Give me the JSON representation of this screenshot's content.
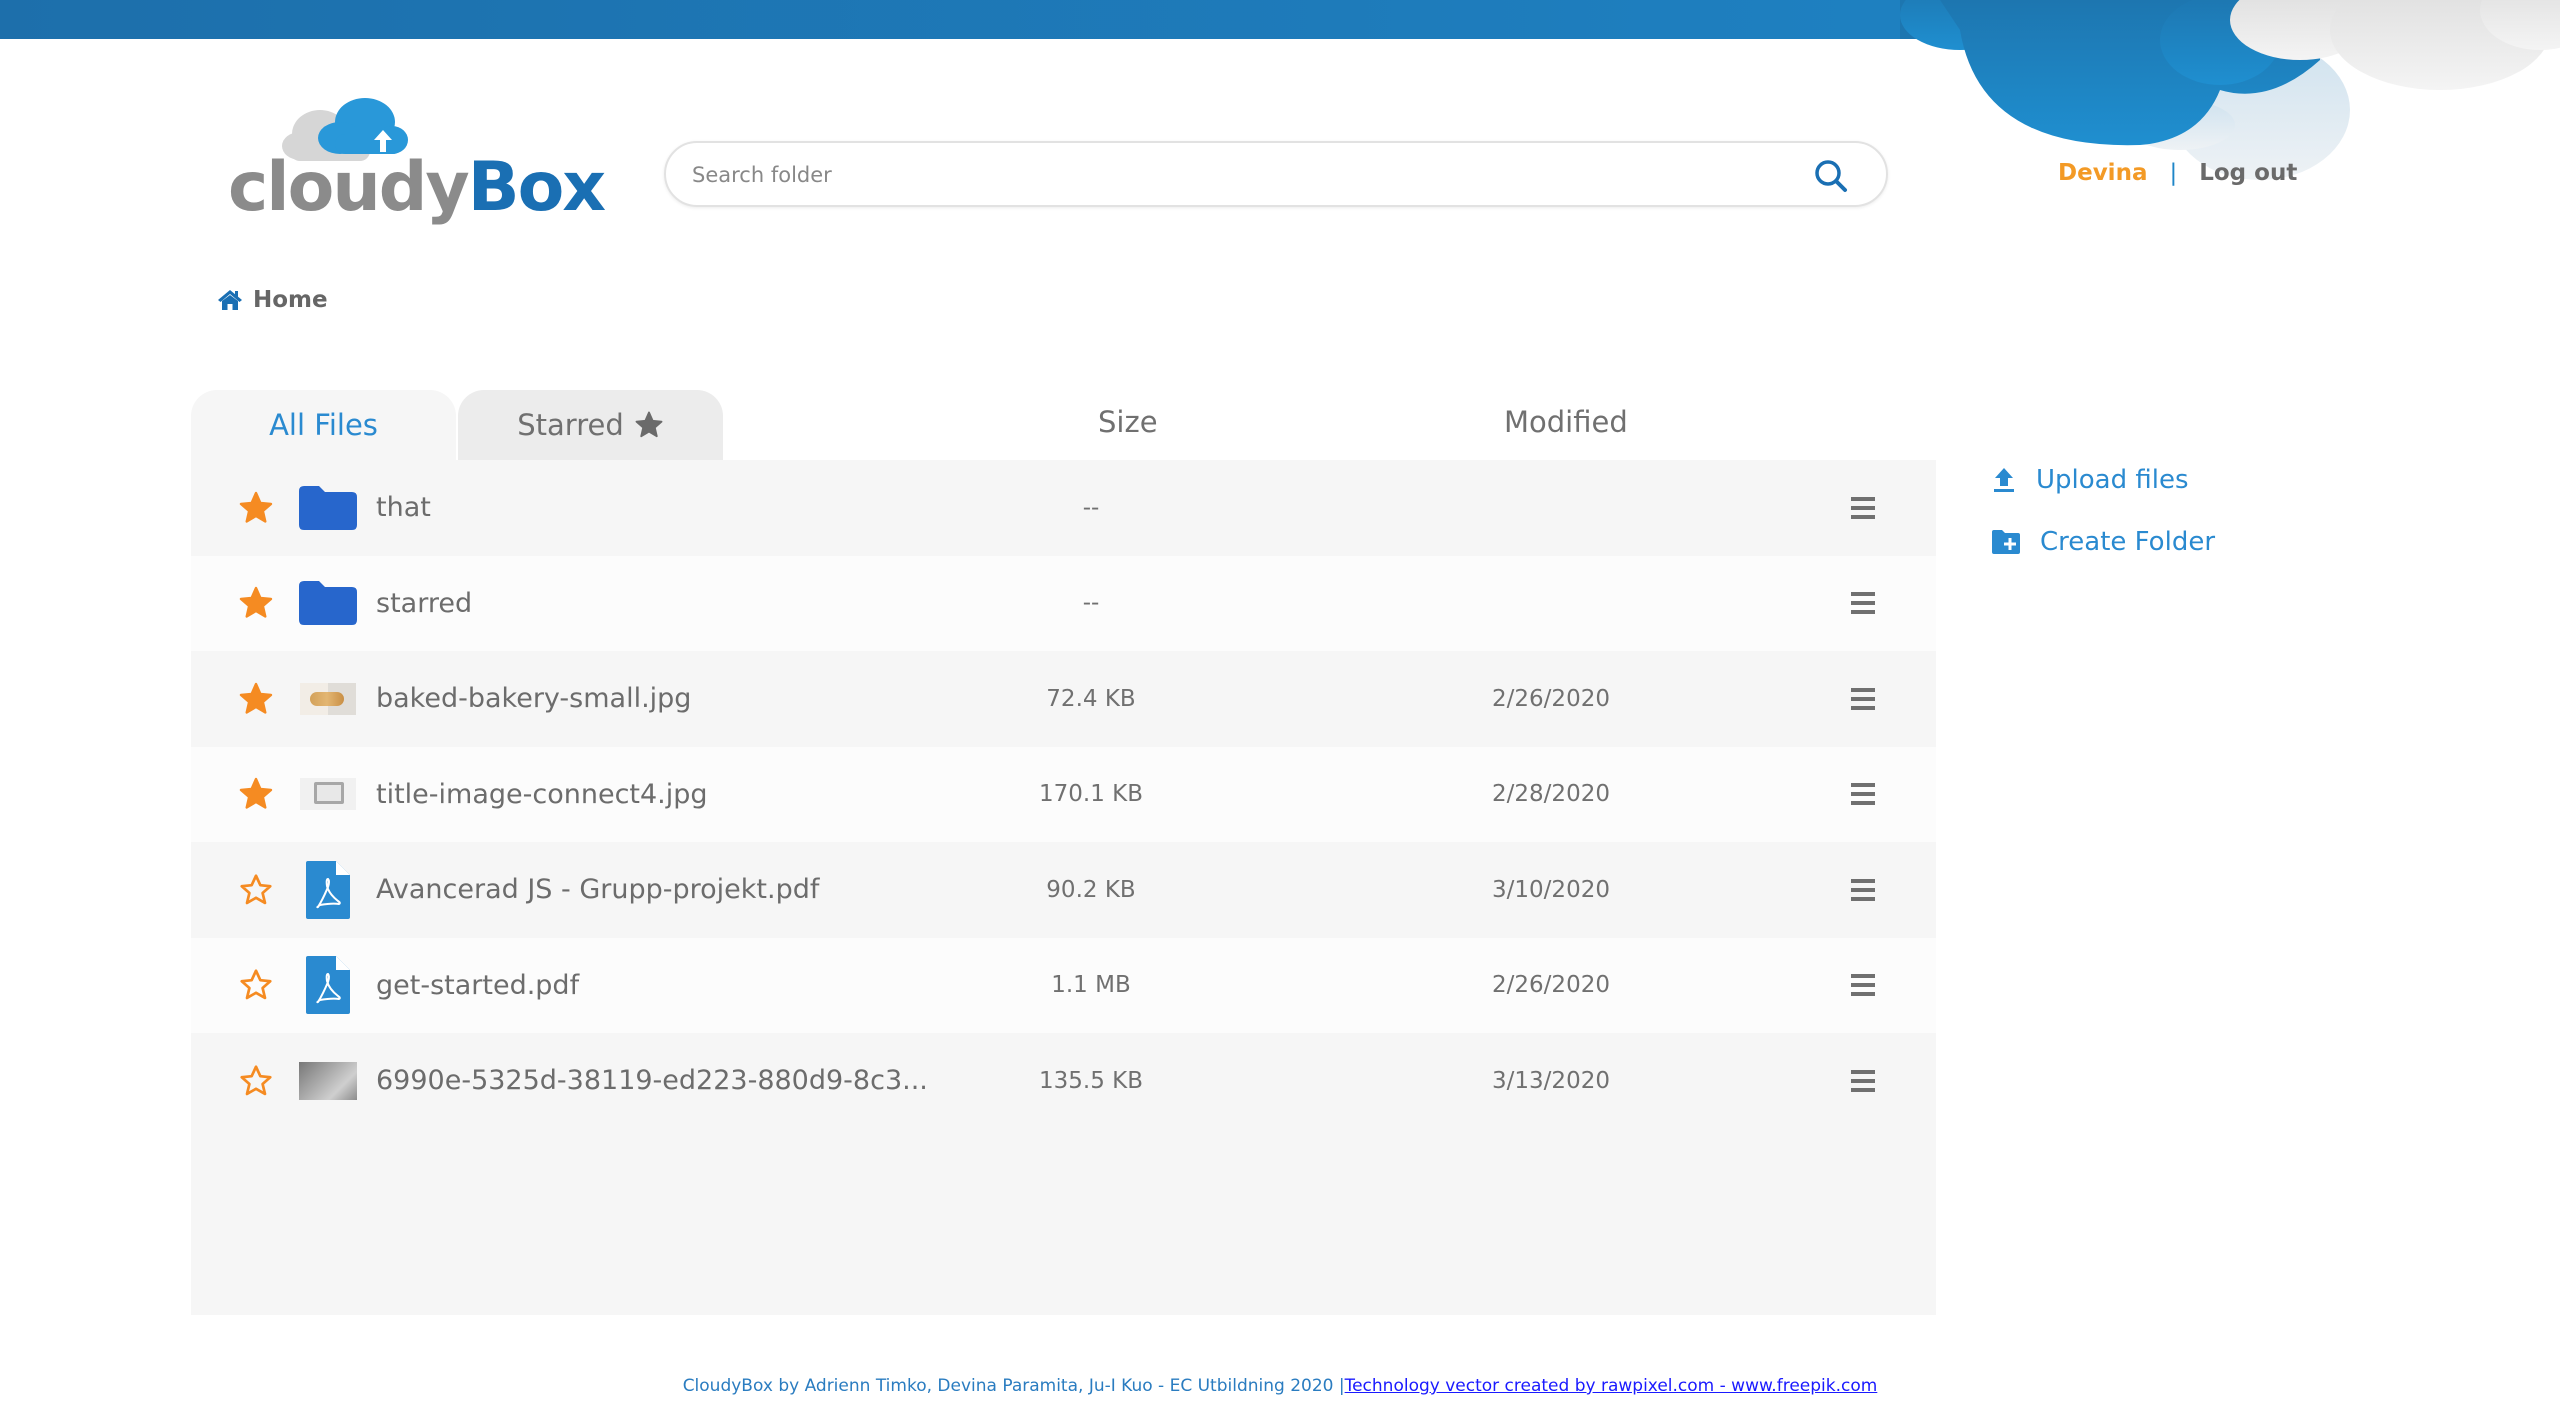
{
  "header": {
    "logo": {
      "part1": "cloudy",
      "part2": "Box"
    },
    "search": {
      "placeholder": "Search folder",
      "value": ""
    },
    "user": {
      "name": "Devina",
      "separator": "|",
      "logout": "Log out"
    }
  },
  "breadcrumb": {
    "items": [
      "Home"
    ]
  },
  "tabs": [
    {
      "label": "All Files",
      "active": true
    },
    {
      "label": "Starred",
      "active": false
    }
  ],
  "columns": {
    "size": "Size",
    "modified": "Modified"
  },
  "files": [
    {
      "name": "that",
      "type": "folder",
      "starred": true,
      "size": "--",
      "modified": ""
    },
    {
      "name": "starred",
      "type": "folder",
      "starred": true,
      "size": "--",
      "modified": ""
    },
    {
      "name": "baked-bakery-small.jpg",
      "type": "image",
      "starred": true,
      "size": "72.4 KB",
      "modified": "2/26/2020"
    },
    {
      "name": "title-image-connect4.jpg",
      "type": "image",
      "starred": true,
      "size": "170.1 KB",
      "modified": "2/28/2020"
    },
    {
      "name": "Avancerad JS - Grupp-projekt.pdf",
      "type": "pdf",
      "starred": false,
      "size": "90.2 KB",
      "modified": "3/10/2020"
    },
    {
      "name": "get-started.pdf",
      "type": "pdf",
      "starred": false,
      "size": "1.1 MB",
      "modified": "2/26/2020"
    },
    {
      "name": "6990e-5325d-38119-ed223-880d9-8c3...",
      "type": "image",
      "starred": false,
      "size": "135.5 KB",
      "modified": "3/13/2020"
    }
  ],
  "actions": [
    {
      "label": "Upload files",
      "icon": "upload-icon"
    },
    {
      "label": "Create Folder",
      "icon": "create-folder-icon"
    }
  ],
  "footer": {
    "credits": "CloudyBox by Adrienn Timko, Devina Paramita, Ju-I Kuo - EC Utbildning 2020 |",
    "link": "Technology vector created by rawpixel.com - www.freepik.com"
  },
  "colors": {
    "brand_blue": "#1a6fb3",
    "accent_blue": "#2a8ad0",
    "star_orange": "#f58b22",
    "user_orange": "#f39a26",
    "folder_blue": "#2766cc"
  }
}
